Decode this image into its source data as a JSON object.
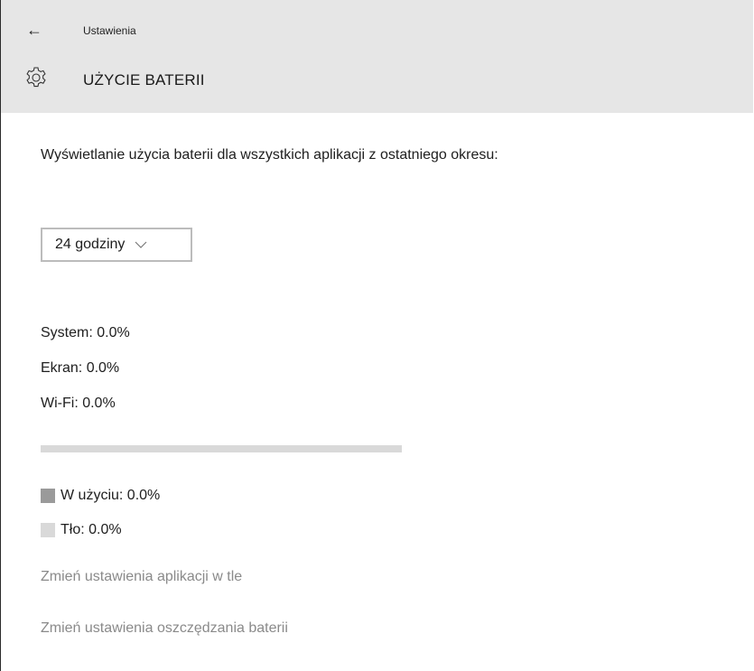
{
  "titlebar": {
    "back_label": "←",
    "app_title": "Ustawienia"
  },
  "header": {
    "icon": "gear-icon",
    "title": "UŻYCIE BATERII"
  },
  "main": {
    "description": "Wyświetlanie użycia baterii dla wszystkich aplikacji z ostatniego okresu:",
    "period_select": {
      "value": "24 godziny"
    },
    "stats": [
      {
        "label": "System: 0.0%"
      },
      {
        "label": "Ekran: 0.0%"
      },
      {
        "label": "Wi-Fi: 0.0%"
      }
    ],
    "usage_bar": {
      "in_use_fraction": 0.0
    },
    "legend": [
      {
        "label": "W użyciu: 0.0%",
        "color": "#9a9a9a"
      },
      {
        "label": "Tło: 0.0%",
        "color": "#d9d9d9"
      }
    ],
    "links": [
      {
        "label": "Zmień ustawienia aplikacji w tle"
      },
      {
        "label": "Zmień ustawienia oszczędzania baterii"
      }
    ]
  },
  "colors": {
    "header_bg": "#e6e6e6",
    "link": "#8a8a8a"
  }
}
